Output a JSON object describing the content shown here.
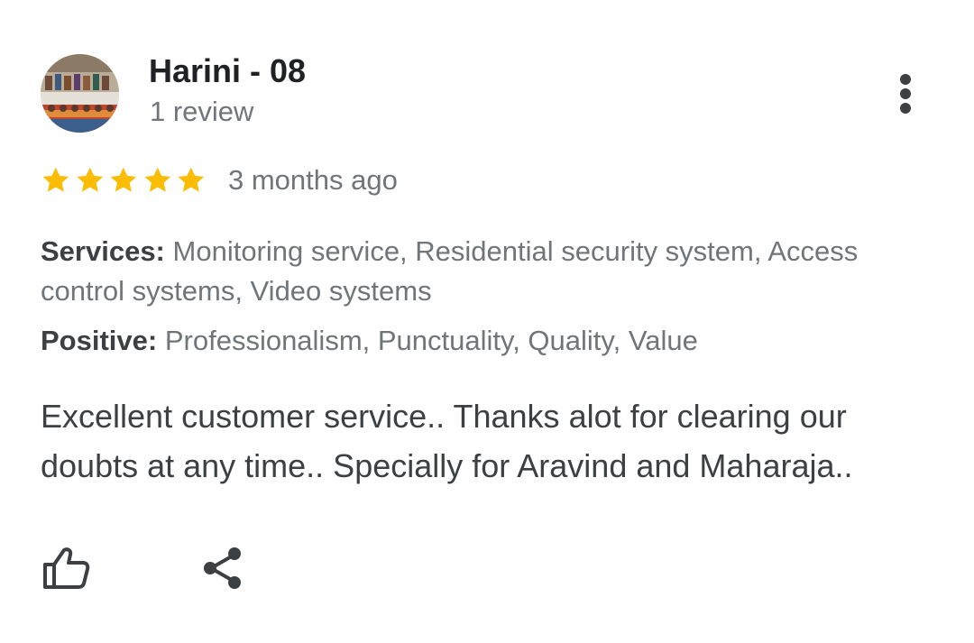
{
  "review": {
    "author_name": "Harini - 08",
    "author_meta": "1 review",
    "rating": 5,
    "rating_max": 5,
    "date": "3 months ago",
    "services_label": "Services:",
    "services_value": "Monitoring service, Residential security system, Access control systems, Video systems",
    "positive_label": "Positive:",
    "positive_value": "Professionalism, Punctuality, Quality, Value",
    "text": "Excellent customer service.. Thanks alot for clearing our doubts at any time.. Specially for Aravind and Maharaja.."
  },
  "icons": {
    "more": "more-vert-icon",
    "like": "thumb-up-icon",
    "share": "share-icon",
    "star": "star-icon"
  },
  "colors": {
    "star": "#fbbc04",
    "primary_text": "#202124",
    "secondary_text": "#70757a",
    "icon": "#3c4043"
  }
}
